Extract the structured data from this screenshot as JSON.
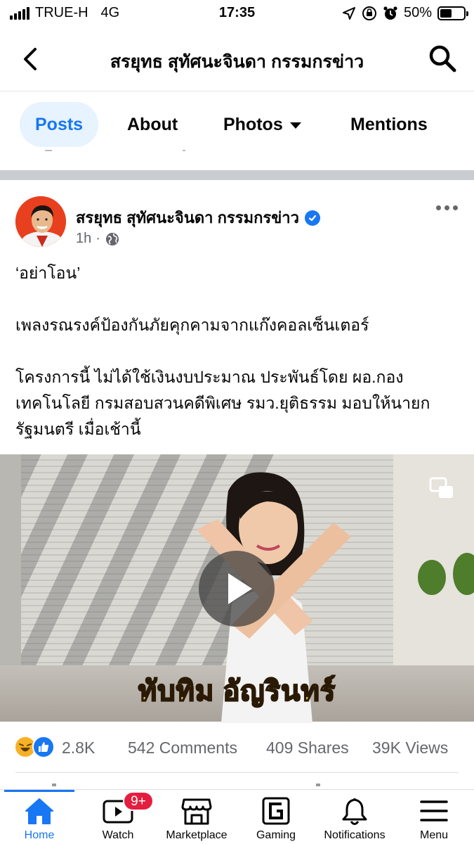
{
  "status_bar": {
    "carrier": "TRUE-H",
    "network": "4G",
    "time": "17:35",
    "battery": "50%",
    "battery_level": 0.5
  },
  "header": {
    "title": "สรยุทธ สุทัศนะจินดา กรรมกรข่าว",
    "back_icon": "chevron-left-icon",
    "search_icon": "search-icon"
  },
  "tabs": [
    {
      "label": "Posts",
      "active": true
    },
    {
      "label": "About",
      "active": false
    },
    {
      "label": "Photos",
      "active": false
    },
    {
      "label": "Mentions",
      "active": false
    }
  ],
  "post": {
    "author": "สรยุทธ สุทัศนะจินดา กรรมกรข่าว",
    "verified": true,
    "time": "1h",
    "audience_icon": "globe-icon",
    "text": [
      "‘อย่าโอน’",
      "เพลงรณรงค์ป้องกันภัยคุกคามจากแก๊งคอลเซ็นเตอร์",
      "โครงการนี้ ไม่ได้ใช้เงินงบประมาณ ประพันธ์โดย ผอ.กองเทคโนโลยี กรมสอบสวนคดีพิเศษ รมว.ยุติธรรม มอบให้นายกรัฐมนตรี เมื่อเช้านี้"
    ],
    "video_caption": "ทับทิม อัญรินทร์",
    "reaction_count": "2.8K",
    "comments": "542 Comments",
    "shares": "409 Shares",
    "views": "39K Views"
  },
  "bottom_nav": {
    "items": [
      {
        "label": "Home",
        "icon": "home-icon",
        "active": true
      },
      {
        "label": "Watch",
        "icon": "watch-icon",
        "badge": "9+"
      },
      {
        "label": "Marketplace",
        "icon": "marketplace-icon"
      },
      {
        "label": "Gaming",
        "icon": "gaming-icon"
      },
      {
        "label": "Notifications",
        "icon": "bell-icon"
      },
      {
        "label": "Menu",
        "icon": "menu-icon"
      }
    ]
  },
  "colors": {
    "accent": "#1877f2",
    "active_tab_bg": "#e7f3ff",
    "badge": "#e41e3f",
    "secondary_text": "#65676b",
    "caption_text": "#f6d438"
  }
}
